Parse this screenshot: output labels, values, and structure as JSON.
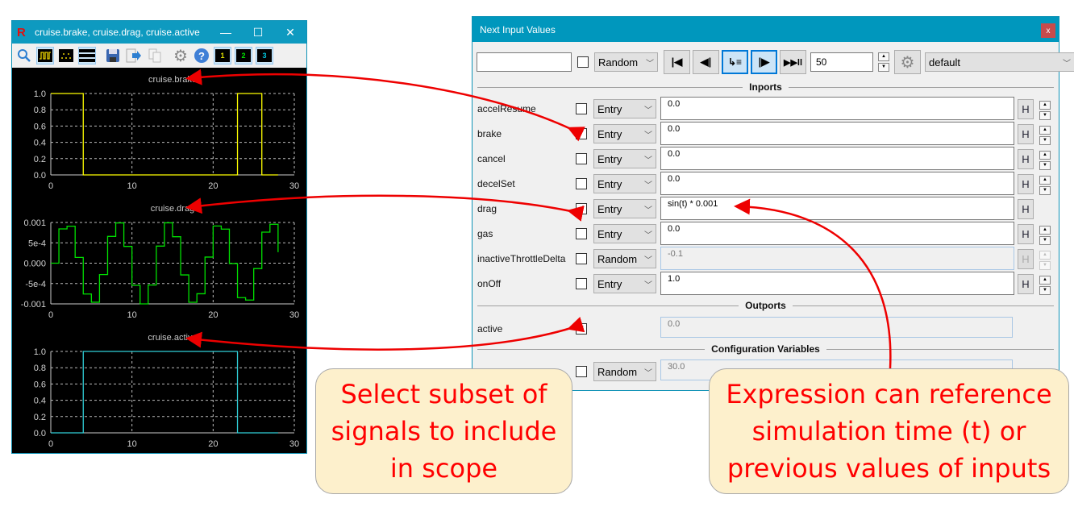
{
  "scope": {
    "title": "cruise.brake, cruise.drag, cruise.active",
    "window_buttons": {
      "minimize": "—",
      "maximize": "☐",
      "close": "✕"
    },
    "toolbar": {
      "icons": [
        "search-icon",
        "step-plot-icon",
        "dot-plot-icon",
        "stacked-layout-icon",
        "save-icon",
        "export-icon",
        "copy-icon",
        "settings-icon",
        "help-icon"
      ],
      "layout_buttons": [
        {
          "label": "1",
          "color": "#e0e000"
        },
        {
          "label": "2",
          "color": "#00e000"
        },
        {
          "label": "3",
          "color": "#00c8e0"
        }
      ]
    }
  },
  "chart_data": [
    {
      "type": "line",
      "title": "cruise.brake",
      "color": "#ffff00",
      "step": true,
      "x": [
        0,
        1,
        2,
        3,
        4,
        5,
        6,
        7,
        8,
        9,
        10,
        11,
        12,
        13,
        14,
        15,
        16,
        17,
        18,
        19,
        20,
        21,
        22,
        23,
        24,
        25,
        26,
        27,
        28
      ],
      "y": [
        1,
        1,
        1,
        1,
        0,
        0,
        0,
        0,
        0,
        0,
        0,
        0,
        0,
        0,
        0,
        0,
        0,
        0,
        0,
        0,
        0,
        0,
        0,
        1,
        1,
        1,
        0,
        0,
        0
      ],
      "xlim": [
        0,
        30
      ],
      "ylim": [
        0,
        1
      ],
      "xticks": [
        "0",
        "10",
        "20",
        "30"
      ],
      "yticks": [
        "0.0",
        "0.2",
        "0.4",
        "0.6",
        "0.8",
        "1.0"
      ],
      "grid": true
    },
    {
      "type": "line",
      "title": "cruise.drag",
      "color": "#00e000",
      "step": true,
      "x": [
        0,
        1,
        2,
        3,
        4,
        5,
        6,
        7,
        8,
        9,
        10,
        11,
        12,
        13,
        14,
        15,
        16,
        17,
        18,
        19,
        20,
        21,
        22,
        23,
        24,
        25,
        26,
        27,
        28
      ],
      "y": [
        0,
        0.000841,
        0.000909,
        0.000141,
        -0.000757,
        -0.000959,
        -0.000279,
        0.000657,
        0.000989,
        0.000412,
        -0.000544,
        -0.001,
        -0.000537,
        0.00042,
        0.000991,
        0.00065,
        -0.000288,
        -0.000961,
        -0.000751,
        0.00015,
        0.000913,
        0.000837,
        -9e-06,
        -0.000846,
        -0.000906,
        -0.000132,
        0.000763,
        0.000956,
        0.00027
      ],
      "xlim": [
        0,
        30
      ],
      "ylim": [
        -0.001,
        0.001
      ],
      "xticks": [
        "0",
        "10",
        "20",
        "30"
      ],
      "yticks": [
        "-0.001",
        "-5e-4",
        "0.000",
        "5e-4",
        "0.001"
      ],
      "grid": true
    },
    {
      "type": "line",
      "title": "cruise.active",
      "color": "#30d0d8",
      "step": true,
      "x": [
        0,
        1,
        2,
        3,
        4,
        5,
        6,
        7,
        8,
        9,
        10,
        11,
        12,
        13,
        14,
        15,
        16,
        17,
        18,
        19,
        20,
        21,
        22,
        23,
        24,
        25,
        26,
        27,
        28
      ],
      "y": [
        0,
        0,
        0,
        0,
        1,
        1,
        1,
        1,
        1,
        1,
        1,
        1,
        1,
        1,
        1,
        1,
        1,
        1,
        1,
        1,
        1,
        1,
        1,
        0,
        0,
        0,
        0,
        0,
        0
      ],
      "xlim": [
        0,
        30
      ],
      "ylim": [
        0,
        1
      ],
      "xticks": [
        "0",
        "10",
        "20",
        "30"
      ],
      "yticks": [
        "0.0",
        "0.2",
        "0.4",
        "0.6",
        "0.8",
        "1.0"
      ],
      "grid": true
    }
  ],
  "inputs": {
    "title": "Next Input Values",
    "close_label": "x",
    "toolbar": {
      "text_value": "",
      "mode": "Random",
      "steps": "50",
      "profile": "default",
      "buttons": [
        "reset-icon",
        "step-back-icon",
        "stop-at-end-icon",
        "step-forward-icon",
        "run-pause-icon"
      ]
    },
    "sections": {
      "inports": "Inports",
      "outports": "Outports",
      "config": "Configuration Variables"
    },
    "inports": [
      {
        "name": "accelResume",
        "checked": false,
        "mode": "Entry",
        "value": "0.0",
        "disabled": false,
        "spinner": true
      },
      {
        "name": "brake",
        "checked": true,
        "mode": "Entry",
        "value": "0.0",
        "disabled": false,
        "spinner": true
      },
      {
        "name": "cancel",
        "checked": false,
        "mode": "Entry",
        "value": "0.0",
        "disabled": false,
        "spinner": true
      },
      {
        "name": "decelSet",
        "checked": false,
        "mode": "Entry",
        "value": "0.0",
        "disabled": false,
        "spinner": true
      },
      {
        "name": "drag",
        "checked": true,
        "mode": "Entry",
        "value": "sin(t) * 0.001",
        "disabled": false,
        "spinner": false
      },
      {
        "name": "gas",
        "checked": false,
        "mode": "Entry",
        "value": "0.0",
        "disabled": false,
        "spinner": true
      },
      {
        "name": "inactiveThrottleDelta",
        "checked": false,
        "mode": "Random",
        "value": "-0.1",
        "disabled": true,
        "spinner": true
      },
      {
        "name": "onOff",
        "checked": false,
        "mode": "Entry",
        "value": "1.0",
        "disabled": false,
        "spinner": true
      }
    ],
    "h_label": "H",
    "outports": [
      {
        "name": "active",
        "checked": true,
        "value": "0.0"
      }
    ],
    "config": [
      {
        "name": "",
        "checked": false,
        "mode": "Random",
        "value": "30.0"
      }
    ]
  },
  "callouts": {
    "left": "Select subset of signals to include in scope",
    "right": "Expression can reference simulation time (t) or previous values of inputs"
  },
  "annotation_color": "#ee0000"
}
